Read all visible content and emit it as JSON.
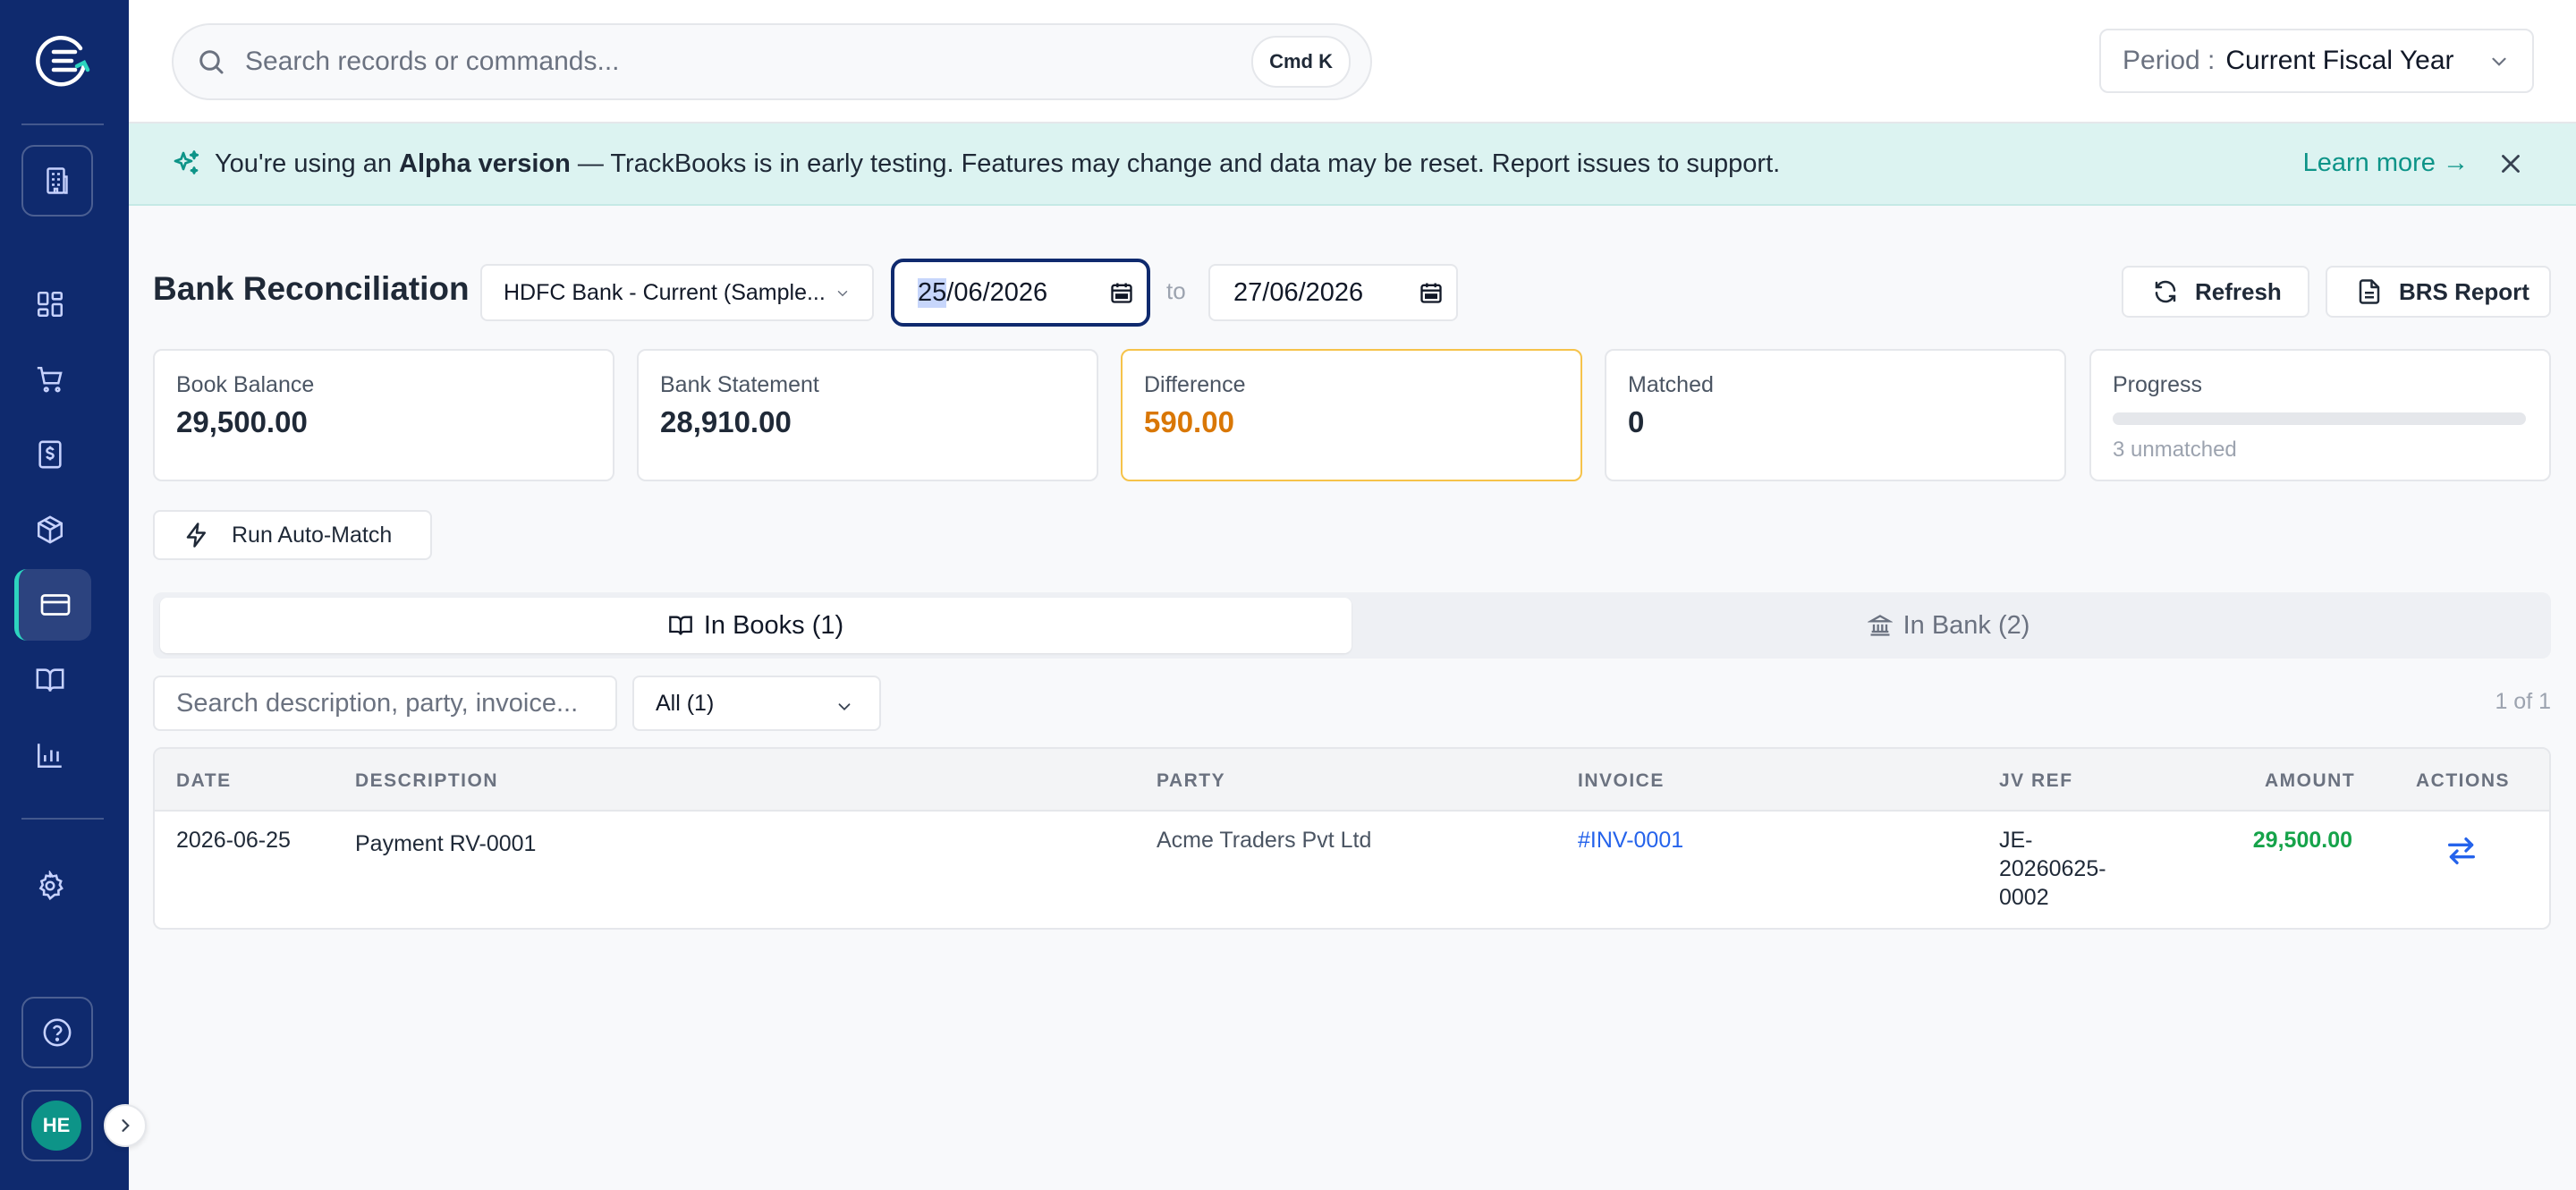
{
  "sidebar": {
    "avatar_initials": "HE",
    "nav_icons": [
      "dashboard-icon",
      "cart-icon",
      "dollar-document-icon",
      "package-icon",
      "credit-card-icon",
      "book-icon",
      "bar-chart-icon",
      "settings-icon"
    ],
    "active_item": "credit-card-icon",
    "accent_color": "#2dd4bf",
    "bg_color": "#0f2a6e"
  },
  "topbar": {
    "search_placeholder": "Search records or commands...",
    "shortcut_label": "Cmd K",
    "period_label": "Period :",
    "period_value": "Current Fiscal Year"
  },
  "banner": {
    "prefix": "You're using an ",
    "bold": "Alpha version",
    "suffix": " — TrackBooks is in early testing. Features may change and data may be reset. Report issues to support.",
    "learn_more": "Learn more →"
  },
  "header": {
    "title": "Bank Reconciliation",
    "account_select": "HDFC Bank - Current (Sample...",
    "date_from_day": "25",
    "date_from_rest": "/06/2026",
    "to_label": "to",
    "date_to": "27/06/2026",
    "refresh_label": "Refresh",
    "brs_label": "BRS Report"
  },
  "stats": {
    "book_balance_label": "Book Balance",
    "book_balance_value": "29,500.00",
    "bank_statement_label": "Bank Statement",
    "bank_statement_value": "28,910.00",
    "difference_label": "Difference",
    "difference_value": "590.00",
    "matched_label": "Matched",
    "matched_value": "0",
    "progress_label": "Progress",
    "progress_fraction": 0,
    "progress_sub": "3 unmatched"
  },
  "actions": {
    "auto_match_label": "Run Auto-Match"
  },
  "tabs": [
    {
      "label": "In Books (1)",
      "active": true
    },
    {
      "label": "In Bank (2)",
      "active": false
    }
  ],
  "table_filters": {
    "search_placeholder": "Search description, party, invoice...",
    "filter_value": "All (1)",
    "pager": "1 of 1"
  },
  "table": {
    "columns": [
      "DATE",
      "DESCRIPTION",
      "PARTY",
      "INVOICE",
      "JV REF",
      "AMOUNT",
      "ACTIONS"
    ],
    "rows": [
      {
        "date": "2026-06-25",
        "description": "Payment RV-0001",
        "party": "Acme Traders Pvt Ltd",
        "invoice": "#INV-0001",
        "jv_ref_1": "JE-",
        "jv_ref_2": "20260625-",
        "jv_ref_3": "0002",
        "amount": "29,500.00",
        "action_icon": "swap-arrows-icon"
      }
    ]
  }
}
